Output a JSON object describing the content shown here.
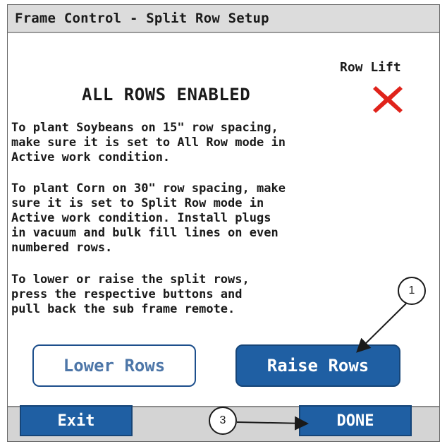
{
  "window": {
    "title": "Frame Control - Split Row Setup"
  },
  "row_lift": {
    "label": "Row Lift",
    "status_icon": "red-x-icon",
    "status_color": "#e0231b"
  },
  "status": {
    "heading": "ALL ROWS ENABLED"
  },
  "instructions": {
    "paragraph_1": "To plant Soybeans on 15\" row spacing,\nmake sure it is set to All Row mode in\nActive work condition.",
    "paragraph_2": "To plant Corn on 30\" row spacing, make\nsure it is set to Split Row mode in\nActive work condition. Install plugs\nin vacuum and bulk fill lines on even\nnumbered rows.",
    "paragraph_3": "To lower or raise the split rows,\npress the respective buttons and\npull back the sub frame remote."
  },
  "buttons": {
    "lower_rows": "Lower Rows",
    "raise_rows": "Raise Rows",
    "exit": "Exit",
    "done": "DONE"
  },
  "callouts": {
    "raise_rows_callout": "1",
    "done_callout": "3"
  },
  "colors": {
    "accent_blue": "#1f5fa3",
    "title_bar": "#dcdcdc",
    "bottom_bar": "#d4d4d4"
  }
}
